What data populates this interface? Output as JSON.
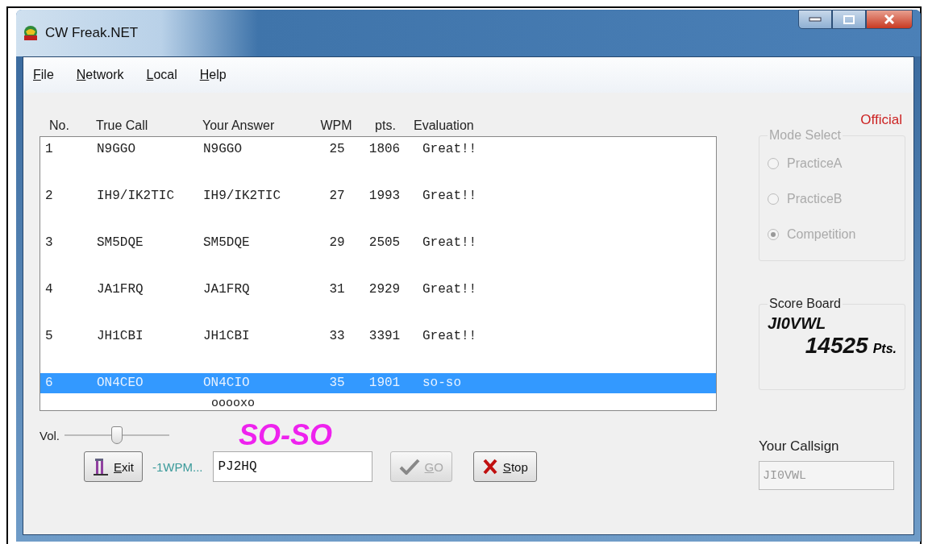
{
  "window": {
    "title": "CW Freak.NET"
  },
  "menu": [
    {
      "label": "File"
    },
    {
      "label": "Network"
    },
    {
      "label": "Local"
    },
    {
      "label": "Help"
    }
  ],
  "table": {
    "columns": [
      "No.",
      "True Call",
      "Your Answer",
      "WPM",
      "pts.",
      "Evaluation"
    ],
    "rows": [
      {
        "cells": [
          "1",
          "N9GGO",
          "N9GGO",
          "25",
          "1806",
          "Great!!"
        ],
        "selected": false
      },
      {
        "cells": [
          "2",
          "IH9/IK2TIC",
          "IH9/IK2TIC",
          "27",
          "1993",
          "Great!!"
        ],
        "selected": false
      },
      {
        "cells": [
          "3",
          "SM5DQE",
          "SM5DQE",
          "29",
          "2505",
          "Great!!"
        ],
        "selected": false
      },
      {
        "cells": [
          "4",
          "JA1FRQ",
          "JA1FRQ",
          "31",
          "2929",
          "Great!!"
        ],
        "selected": false
      },
      {
        "cells": [
          "5",
          "JH1CBI",
          "JH1CBI",
          "33",
          "3391",
          "Great!!"
        ],
        "selected": false
      },
      {
        "cells": [
          "6",
          "ON4CEO",
          "ON4CIO",
          "35",
          "1901",
          "so-so"
        ],
        "selected": true,
        "detail": "ooooxo"
      }
    ]
  },
  "status_label": "Official",
  "mode_select": {
    "title": "Mode Select",
    "disabled": true,
    "options": [
      {
        "label": "PracticeA",
        "selected": false
      },
      {
        "label": "PracticeB",
        "selected": false
      },
      {
        "label": "Competition",
        "selected": true
      }
    ]
  },
  "score_board": {
    "title": "Score Board",
    "callsign": "JI0VWL",
    "score": "14525",
    "unit": "Pts."
  },
  "your_callsign": {
    "label": "Your Callsign",
    "value": "JI0VWL"
  },
  "volume": {
    "label": "Vol.",
    "level": 0.5
  },
  "result": "SO-SO",
  "exit_button": {
    "label": "Exit"
  },
  "speed_note": "-1WPM...",
  "answer_field": {
    "value": "PJ2HQ"
  },
  "go_button": {
    "label": "GO",
    "disabled": true
  },
  "stop_button": {
    "label": "Stop"
  }
}
